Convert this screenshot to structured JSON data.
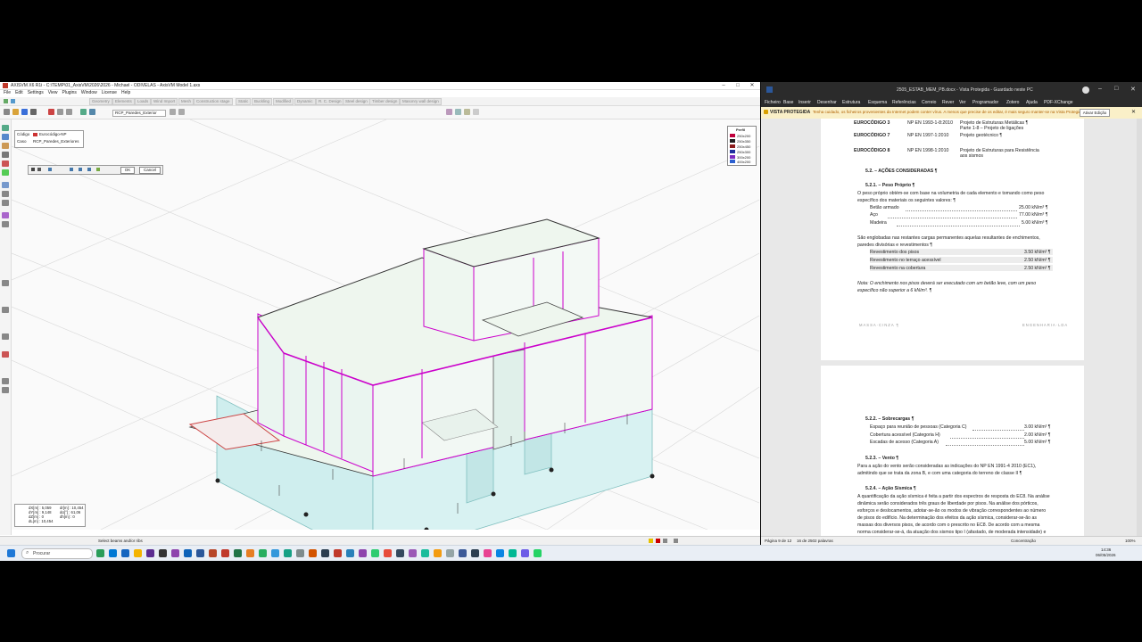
{
  "axisvm": {
    "title": "AXISVM X6 R1i - C:\\TEMP\\01_AxisVM\\2026\\2026 - Michael - ODIVELAS - AxisVM Model 1.axs",
    "menu": [
      "File",
      "Edit",
      "Settings",
      "View",
      "Plugins",
      "Window",
      "License",
      "Help"
    ],
    "tabs": [
      "Geometry",
      "Elements",
      "Loads",
      "Wind Import",
      "Mesh",
      "Construction stage",
      "Static",
      "Buckling",
      "Modified",
      "Dynamic",
      "R. C. Design",
      "Steel design",
      "Timber design",
      "Masonry wall design"
    ],
    "combo_value": "RCP_Paredes_Exterior",
    "props": {
      "code_label": "Código",
      "code_value": "Eurocódigo-NP",
      "case_label": "Caso",
      "case_value": "RCP_Paredes_Exteriores"
    },
    "dialog": {
      "ok": "OK",
      "cancel": "Cancel"
    },
    "legend": {
      "title": "Perfil",
      "items": [
        {
          "label": "250x200",
          "color": "#c0003c"
        },
        {
          "label": "250x350",
          "color": "#202020"
        },
        {
          "label": "250x450",
          "color": "#8a1a1a"
        },
        {
          "label": "250x300",
          "color": "#2030a0"
        },
        {
          "label": "300x200",
          "color": "#7a2ac0"
        },
        {
          "label": "400x200",
          "color": "#2c60d0"
        }
      ]
    },
    "coords": {
      "dx": "dX[m] : 5,059",
      "dy": "dY[m] : 9,148",
      "dz": "dZ[m] : 0",
      "dl": "dL[m] : 10,454",
      "dr": "dr[m] : 10,454",
      "da": "dα[°] : 61,06",
      "dz2": "dh[m] : 0"
    },
    "status": "Select beams and/or ribs"
  },
  "word": {
    "title": "2505_ESTAB_MEM_PB.docx - Vista Protegida - Guardado neste PC",
    "ribbon": [
      "Ficheiro",
      "Base",
      "Inserir",
      "Desenhar",
      "Estrutura",
      "Esquema",
      "Referências",
      "Correio",
      "Rever",
      "Ver",
      "Programador",
      "Zotero",
      "Ajuda",
      "PDF-XChange"
    ],
    "protected_label": "VISTA PROTEGIDA",
    "protected_msg": "Tenha cuidado, os ficheiros provenientes da Internet podem conter vírus. A menos que precise de os editar, é mais seguro manter-se na Vista Protegida.",
    "enable_edit": "Ativar Edição",
    "page1": {
      "ec": [
        {
          "code": "EUROCÓDIGO 3",
          "norm": "NP EN 1993-1-8:2010",
          "desc1": "Projeto de Estruturas Metálicas ¶",
          "desc2": "Parte 1-8 – Projeto de ligações"
        },
        {
          "code": "EUROCÓDIGO 7",
          "norm": "NP EN 1997-1:2010",
          "desc1": "Projeto geotécnico ¶",
          "desc2": ""
        },
        {
          "code": "EUROCÓDIGO 8",
          "norm": "NP EN 1998-1:2010",
          "desc1": "Projeto de Estruturas para Resistência",
          "desc2": "aos sismos"
        }
      ],
      "h52": "5.2. – AÇÕES CONSIDERADAS ¶",
      "h521": "5.2.1. – Peso Próprio ¶",
      "pp_text1": "O peso próprio obtém-se com base na volumetria de cada elemento e tomando como peso",
      "pp_text2": "específico dos materiais os seguintes valores: ¶",
      "materials": [
        {
          "name": "Betão armado",
          "value": "25.00  kN/m³ ¶"
        },
        {
          "name": "Aço",
          "value": "77.00  kN/m³ ¶"
        },
        {
          "name": "Madeira",
          "value": "5.00  kN/m³ ¶"
        }
      ],
      "perm_text1": "São englobadas nas restantes cargas permanentes aquelas resultantes de enchimentos,",
      "perm_text2": "paredes divisórias e revestimentos ¶",
      "finishes": [
        {
          "name": "Revestimento dos pisos",
          "value": "3.50 kN/m² ¶"
        },
        {
          "name": "Revestimento no terraço acessível",
          "value": "2.50 kN/m² ¶"
        },
        {
          "name": "Revestimento na cobertura",
          "value": "2.50 kN/m² ¶"
        }
      ],
      "note1": "Nota: O enchimento nos pisos deverá ser executado com um betão leve, com um peso",
      "note2": "específico não superior a 6 kN/m³. ¶",
      "footer_left": "MASSA·CINZA ¶",
      "footer_right": "ENGENHARIA·LDA"
    },
    "page2": {
      "h522": "5.2.2. – Sobrecargas ¶",
      "loads": [
        {
          "name": "Espaço para reunião de pessoas (Categoria C)",
          "value": "3.00 kN/m² ¶"
        },
        {
          "name": "Cobertura acessível (Categoria H)",
          "value": "2.00 kN/m² ¶"
        },
        {
          "name": "Escadas de acesso (Categoria A)",
          "value": "5.00 kN/m² ¶"
        }
      ],
      "h523": "5.2.3. – Vento ¶",
      "wind1": "Para a ação do vento serão consideradas as indicações do NP EN 1991-4 2010 (EC1),",
      "wind2": "admitindo que se trata da zona B, e com uma categoria do terreno de classe II ¶",
      "h524": "5.2.4. – Ação Sísmica ¶",
      "seis": [
        "A quantificação da ação sísmica é feita a partir dos espectros de resposta do EC8. Na análise",
        "dinâmica serão considerados três graus de liberdade por pisos. Na análise dos pórticos,",
        "esforços e deslocamentos, adotar-se-ão os modos de vibração correspondentes ao número",
        "de pisos do edifício. Na determinação dos efeitos da ação sísmica, considerar-se-ão as",
        "massas dos diversos pisos, de acordo com o prescrito no EC8. De acordo com a mesma",
        "norma considerar-se-á, da atuação dos sismos tipo I (afastado, de moderada intensidade) e"
      ]
    },
    "status_page": "Página 9 de 12",
    "status_words": "16 de 2502 palavras",
    "status_focus": "Concentração",
    "status_zoom": "100%"
  },
  "taskbar": {
    "search": "Procurar",
    "time": "14:36",
    "date": "06/05/2026"
  }
}
